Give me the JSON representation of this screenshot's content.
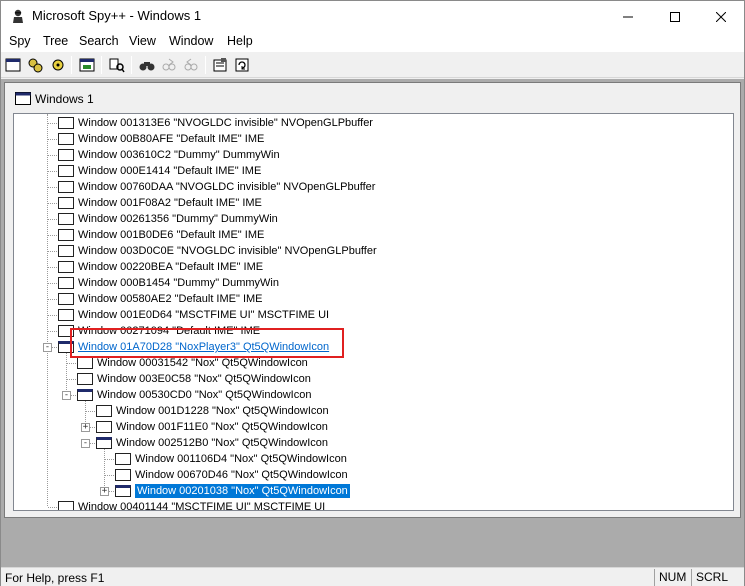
{
  "window": {
    "title": "Microsoft Spy++ - Windows 1"
  },
  "menu": [
    "Spy",
    "Tree",
    "Search",
    "View",
    "Window",
    "Help"
  ],
  "toolbar": {
    "buttons": [
      "windows-icon",
      "processes-icon",
      "threads-icon",
      "messages-icon",
      "log-messages-icon",
      "find-window-icon",
      "find-next-icon",
      "find-prev-icon",
      "properties-icon",
      "refresh-icon"
    ]
  },
  "child": {
    "title": "Windows 1"
  },
  "tree": {
    "rows": [
      {
        "label": "Window 001313E6 \"NVOGLDC invisible\" NVOpenGLPbuffer"
      },
      {
        "label": "Window 00B80AFE \"Default IME\" IME"
      },
      {
        "label": "Window 003610C2 \"Dummy\" DummyWin"
      },
      {
        "label": "Window 000E1414 \"Default IME\" IME"
      },
      {
        "label": "Window 00760DAA \"NVOGLDC invisible\" NVOpenGLPbuffer"
      },
      {
        "label": "Window 001F08A2 \"Default IME\" IME"
      },
      {
        "label": "Window 00261356 \"Dummy\" DummyWin"
      },
      {
        "label": "Window 001B0DE6 \"Default IME\" IME"
      },
      {
        "label": "Window 003D0C0E \"NVOGLDC invisible\" NVOpenGLPbuffer"
      },
      {
        "label": "Window 00220BEA \"Default IME\" IME"
      },
      {
        "label": "Window 000B1454 \"Dummy\" DummyWin"
      },
      {
        "label": "Window 00580AE2 \"Default IME\" IME"
      },
      {
        "label": "Window 001E0D64 \"MSCTFIME UI\" MSCTFIME UI"
      },
      {
        "label": "Window 00271094 \"Default IME\" IME"
      },
      {
        "label": "Window 01A70D28 \"NoxPlayer3\" Qt5QWindowIcon"
      },
      {
        "label": "Window 00031542 \"Nox\" Qt5QWindowIcon"
      },
      {
        "label": "Window 003E0C58 \"Nox\" Qt5QWindowIcon"
      },
      {
        "label": "Window 00530CD0 \"Nox\" Qt5QWindowIcon"
      },
      {
        "label": "Window 001D1228 \"Nox\" Qt5QWindowIcon"
      },
      {
        "label": "Window 001F11E0 \"Nox\" Qt5QWindowIcon"
      },
      {
        "label": "Window 002512B0 \"Nox\" Qt5QWindowIcon"
      },
      {
        "label": "Window 001106D4 \"Nox\" Qt5QWindowIcon"
      },
      {
        "label": "Window 00670D46 \"Nox\" Qt5QWindowIcon"
      },
      {
        "label": "Window 00201038 \"Nox\" Qt5QWindowIcon"
      },
      {
        "label": "Window 00401144 \"MSCTFIME UI\" MSCTFIME UI"
      }
    ]
  },
  "status": {
    "text": "For Help, press F1",
    "num": "NUM",
    "scrl": "SCRL"
  },
  "colors": {
    "selection": "#0078d7",
    "highlight_box": "#e02020",
    "link": "#0066cc"
  }
}
